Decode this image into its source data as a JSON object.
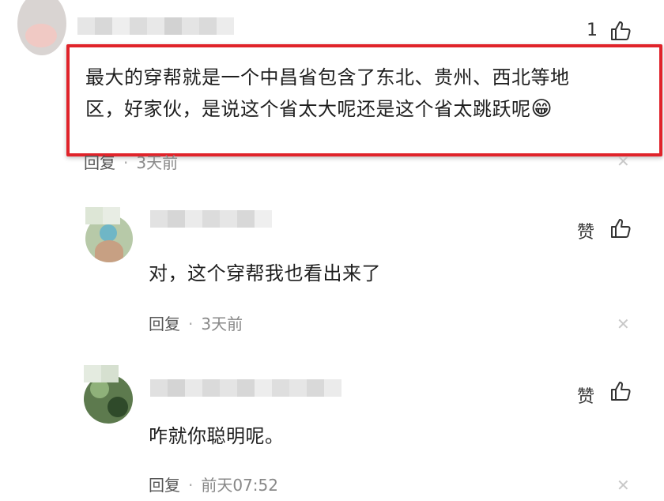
{
  "top_comment": {
    "like_count": "1",
    "text_line1": "最大的穿帮就是一个中昌省包含了东北、贵州、西北等地",
    "text_line2": "区，好家伙，是说这个省太大呢还是这个省太跳跃呢",
    "emoji": "😁",
    "reply_label": "回复",
    "time": "3天前"
  },
  "replies": [
    {
      "like_label": "赞",
      "text": "对，这个穿帮我也看出来了",
      "reply_label": "回复",
      "time": "3天前"
    },
    {
      "like_label": "赞",
      "text": "咋就你聪明呢。",
      "reply_label": "回复",
      "time": "前天07:52"
    }
  ],
  "colors": {
    "highlight_border": "#e0232a",
    "text": "#1e1e1e",
    "meta_time": "#888888"
  },
  "icons": [
    "thumb-up-icon",
    "close-icon",
    "grin-emoji"
  ]
}
